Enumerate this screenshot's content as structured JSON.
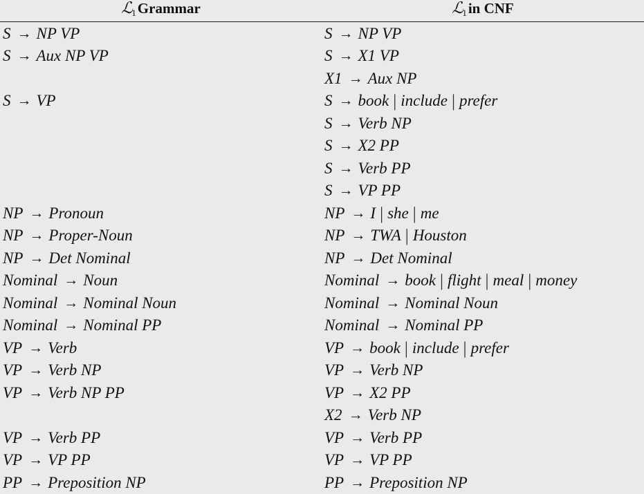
{
  "table": {
    "headers": [
      {
        "prefix_symbol": "L",
        "subscript": "1",
        "label": "Grammar"
      },
      {
        "prefix_symbol": "L",
        "subscript": "1",
        "label": "in CNF"
      }
    ],
    "separator": "|",
    "arrow": "→",
    "rows": [
      {
        "left": {
          "lhs": "S",
          "rhs": [
            "NP VP"
          ]
        },
        "right": {
          "lhs": "S",
          "rhs": [
            "NP VP"
          ]
        }
      },
      {
        "left": {
          "lhs": "S",
          "rhs": [
            "Aux NP VP"
          ]
        },
        "right": {
          "lhs": "S",
          "rhs": [
            "X1 VP"
          ]
        }
      },
      {
        "left": null,
        "right": {
          "lhs": "X1",
          "rhs": [
            "Aux NP"
          ]
        }
      },
      {
        "left": {
          "lhs": "S",
          "rhs": [
            "VP"
          ]
        },
        "right": {
          "lhs": "S",
          "rhs": [
            "book",
            "include",
            "prefer"
          ]
        }
      },
      {
        "left": null,
        "right": {
          "lhs": "S",
          "rhs": [
            "Verb NP"
          ]
        }
      },
      {
        "left": null,
        "right": {
          "lhs": "S",
          "rhs": [
            "X2 PP"
          ]
        }
      },
      {
        "left": null,
        "right": {
          "lhs": "S",
          "rhs": [
            "Verb PP"
          ]
        }
      },
      {
        "left": null,
        "right": {
          "lhs": "S",
          "rhs": [
            "VP PP"
          ]
        }
      },
      {
        "left": {
          "lhs": "NP",
          "rhs": [
            "Pronoun"
          ]
        },
        "right": {
          "lhs": "NP",
          "rhs": [
            "I",
            "she",
            "me"
          ]
        }
      },
      {
        "left": {
          "lhs": "NP",
          "rhs": [
            "Proper-Noun"
          ]
        },
        "right": {
          "lhs": "NP",
          "rhs": [
            "TWA",
            "Houston"
          ]
        }
      },
      {
        "left": {
          "lhs": "NP",
          "rhs": [
            "Det Nominal"
          ]
        },
        "right": {
          "lhs": "NP",
          "rhs": [
            "Det Nominal"
          ]
        }
      },
      {
        "left": {
          "lhs": "Nominal",
          "rhs": [
            "Noun"
          ]
        },
        "right": {
          "lhs": "Nominal",
          "rhs": [
            "book",
            "flight",
            "meal",
            "money"
          ]
        }
      },
      {
        "left": {
          "lhs": "Nominal",
          "rhs": [
            "Nominal Noun"
          ]
        },
        "right": {
          "lhs": "Nominal",
          "rhs": [
            "Nominal Noun"
          ]
        }
      },
      {
        "left": {
          "lhs": "Nominal",
          "rhs": [
            "Nominal PP"
          ]
        },
        "right": {
          "lhs": "Nominal",
          "rhs": [
            "Nominal PP"
          ]
        }
      },
      {
        "left": {
          "lhs": "VP",
          "rhs": [
            "Verb"
          ]
        },
        "right": {
          "lhs": "VP",
          "rhs": [
            "book",
            "include",
            "prefer"
          ]
        }
      },
      {
        "left": {
          "lhs": "VP",
          "rhs": [
            "Verb NP"
          ]
        },
        "right": {
          "lhs": "VP",
          "rhs": [
            "Verb NP"
          ]
        }
      },
      {
        "left": {
          "lhs": "VP",
          "rhs": [
            "Verb NP PP"
          ]
        },
        "right": {
          "lhs": "VP",
          "rhs": [
            "X2 PP"
          ]
        }
      },
      {
        "left": null,
        "right": {
          "lhs": "X2",
          "rhs": [
            "Verb NP"
          ]
        }
      },
      {
        "left": {
          "lhs": "VP",
          "rhs": [
            "Verb PP"
          ]
        },
        "right": {
          "lhs": "VP",
          "rhs": [
            "Verb PP"
          ]
        }
      },
      {
        "left": {
          "lhs": "VP",
          "rhs": [
            "VP PP"
          ]
        },
        "right": {
          "lhs": "VP",
          "rhs": [
            "VP PP"
          ]
        }
      },
      {
        "left": {
          "lhs": "PP",
          "rhs": [
            "Preposition NP"
          ]
        },
        "right": {
          "lhs": "PP",
          "rhs": [
            "Preposition NP"
          ]
        }
      }
    ]
  },
  "colors": {
    "background": "#eaeaea",
    "text": "#111111",
    "rule_line": "#1a1a1a"
  }
}
